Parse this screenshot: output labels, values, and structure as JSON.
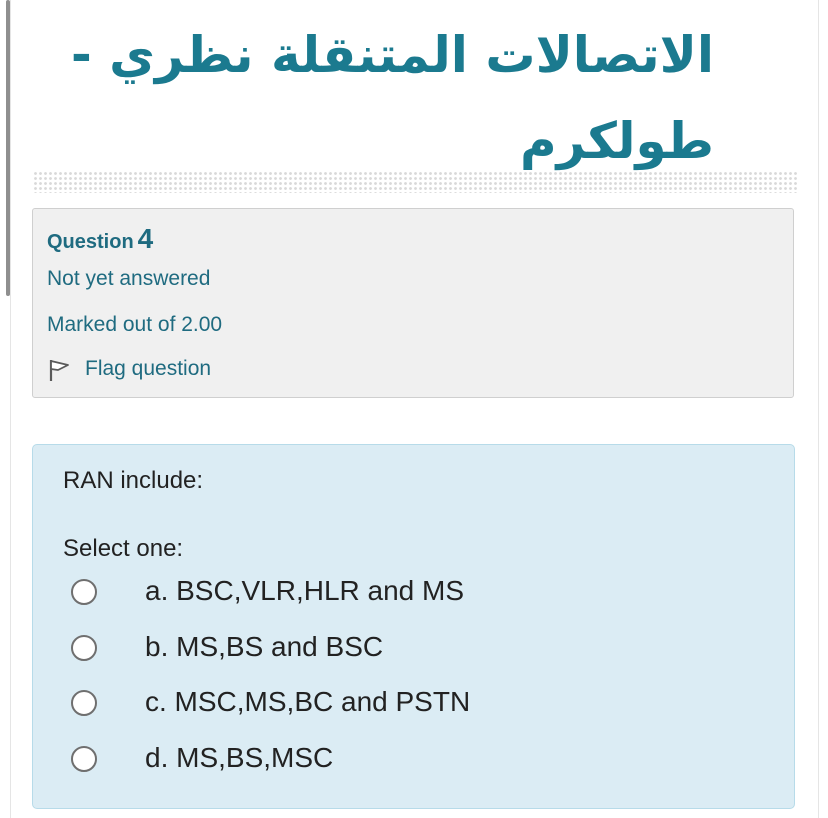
{
  "page": {
    "title": "الاتصالات المتنقلة نظري - طولكرم"
  },
  "question_info": {
    "label": "Question",
    "number": "4",
    "status": "Not yet answered",
    "marks": "Marked out of 2.00",
    "flag_label": "Flag question",
    "flag_icon": "flag-icon"
  },
  "question": {
    "text": "RAN include:",
    "prompt": "Select one:",
    "answers": [
      {
        "label": "a. BSC,VLR,HLR and MS",
        "selected": false
      },
      {
        "label": "b. MS,BS and BSC",
        "selected": false
      },
      {
        "label": "c. MSC,MS,BC and PSTN",
        "selected": false
      },
      {
        "label": "d. MS,BS,MSC",
        "selected": false
      }
    ]
  },
  "colors": {
    "accent": "#1b7a8f",
    "info_bg": "#f0f0f0",
    "formulation_bg": "#dbecf4"
  }
}
